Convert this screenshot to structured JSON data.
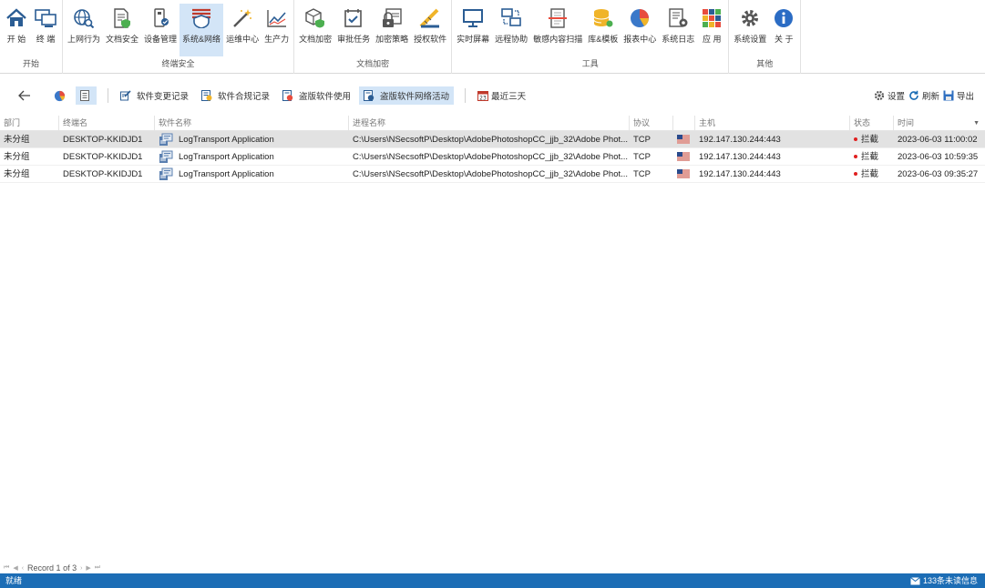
{
  "ribbon": {
    "groups": [
      {
        "title": "开始",
        "items": [
          {
            "label": "开 始",
            "icon": "home-icon"
          },
          {
            "label": "终 端",
            "icon": "terminal-icon"
          }
        ]
      },
      {
        "title": "终端安全",
        "items": [
          {
            "label": "上网行为",
            "icon": "web-behavior-icon"
          },
          {
            "label": "文档安全",
            "icon": "doc-security-icon"
          },
          {
            "label": "设备管理",
            "icon": "device-icon"
          },
          {
            "label": "系统&网络",
            "icon": "firewall-icon",
            "active": true
          },
          {
            "label": "运维中心",
            "icon": "wand-icon"
          },
          {
            "label": "生产力",
            "icon": "chart-icon"
          }
        ]
      },
      {
        "title": "文档加密",
        "items": [
          {
            "label": "文档加密",
            "icon": "cube-shield-icon"
          },
          {
            "label": "审批任务",
            "icon": "checkbox-icon"
          },
          {
            "label": "加密策略",
            "icon": "lock-doc-icon"
          },
          {
            "label": "授权软件",
            "icon": "ruler-icon"
          }
        ]
      },
      {
        "title": "工具",
        "items": [
          {
            "label": "实时屏幕",
            "icon": "monitor-icon"
          },
          {
            "label": "远程协助",
            "icon": "remote-icon"
          },
          {
            "label": "敏感内容扫描",
            "icon": "scan-icon"
          },
          {
            "label": "库&模板",
            "icon": "database-icon"
          },
          {
            "label": "报表中心",
            "icon": "pie-icon"
          },
          {
            "label": "系统日志",
            "icon": "log-icon"
          },
          {
            "label": "应 用",
            "icon": "apps-icon"
          }
        ]
      },
      {
        "title": "其他",
        "items": [
          {
            "label": "系统设置",
            "icon": "gear-icon"
          },
          {
            "label": "关 于",
            "icon": "info-icon"
          }
        ]
      }
    ]
  },
  "toolbar": {
    "tabs": [
      {
        "label": "软件变更记录",
        "icon": "software-change-icon"
      },
      {
        "label": "软件合规记录",
        "icon": "software-compliance-icon"
      },
      {
        "label": "盗版软件使用",
        "icon": "pirated-software-icon"
      },
      {
        "label": "盗版软件网络活动",
        "icon": "pirated-network-icon",
        "active": true
      }
    ],
    "range_label": "最近三天",
    "settings_label": "设置",
    "refresh_label": "刷新",
    "export_label": "导出"
  },
  "grid": {
    "columns": [
      "部门",
      "终端名",
      "软件名称",
      "进程名称",
      "协议",
      "",
      "主机",
      "状态",
      "时间"
    ],
    "rows": [
      {
        "dept": "未分组",
        "terminal": "DESKTOP-KKIDJD1",
        "software": "LogTransport Application",
        "process": "C:\\Users\\NSecsoftP\\Desktop\\AdobePhotoshopCC_jjb_32\\Adobe Phot...",
        "protocol": "TCP",
        "host": "192.147.130.244:443",
        "status": "拦截",
        "time": "2023-06-03 11:00:02"
      },
      {
        "dept": "未分组",
        "terminal": "DESKTOP-KKIDJD1",
        "software": "LogTransport Application",
        "process": "C:\\Users\\NSecsoftP\\Desktop\\AdobePhotoshopCC_jjb_32\\Adobe Phot...",
        "protocol": "TCP",
        "host": "192.147.130.244:443",
        "status": "拦截",
        "time": "2023-06-03 10:59:35"
      },
      {
        "dept": "未分组",
        "terminal": "DESKTOP-KKIDJD1",
        "software": "LogTransport Application",
        "process": "C:\\Users\\NSecsoftP\\Desktop\\AdobePhotoshopCC_jjb_32\\Adobe Phot...",
        "protocol": "TCP",
        "host": "192.147.130.244:443",
        "status": "拦截",
        "time": "2023-06-03 09:35:27"
      }
    ]
  },
  "pager": {
    "text": "Record 1 of 3"
  },
  "statusbar": {
    "left": "就绪",
    "right": "133条未读信息"
  },
  "colors": {
    "accent": "#1c6db5",
    "selected": "#d3e5f7",
    "status_red": "#e02020"
  }
}
